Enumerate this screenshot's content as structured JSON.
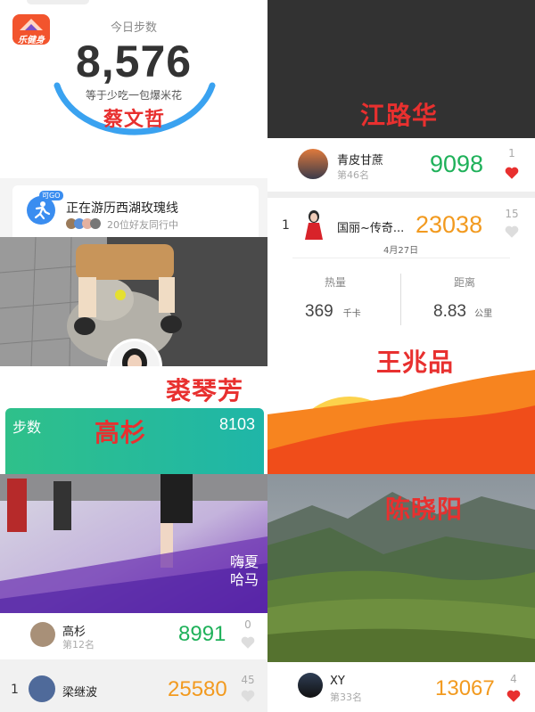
{
  "app": {
    "logo_text": "乐健身"
  },
  "steps_panel": {
    "label": "今日步数",
    "count": "8,576",
    "compare": "等于少吃一包爆米花",
    "person_name": "蔡文哲"
  },
  "challenge": {
    "badge": "可GO",
    "title": "正在游历西湖玫瑰线",
    "friends": "20位好友同行中"
  },
  "photo_left": {
    "person_name": "裘琴芳"
  },
  "green_card": {
    "label": "步数",
    "person_name": "高杉",
    "value": "8103"
  },
  "rank_gaoshan": {
    "name": "高杉",
    "rank": "第12名",
    "steps": "8991",
    "likes": "0"
  },
  "rank_liang": {
    "position": "1",
    "name": "梁继波",
    "steps": "25580",
    "likes": "45"
  },
  "dark_panel": {
    "person_name": "江路华"
  },
  "rank_qing": {
    "name": "青皮甘蔗",
    "rank": "第46名",
    "steps": "9098",
    "likes": "1"
  },
  "rank_guoli": {
    "position": "1",
    "name": "国丽~传奇...",
    "steps": "23038",
    "likes": "15",
    "date": "4月27日",
    "calorie_label": "热量",
    "calorie_value": "369",
    "calorie_unit": "千卡",
    "distance_label": "距离",
    "distance_value": "8.83",
    "distance_unit": "公里",
    "person_name": "王兆品"
  },
  "mountain": {
    "person_name": "陈晓阳"
  },
  "rank_xy": {
    "name": "XY",
    "rank": "第33名",
    "steps": "13067",
    "likes": "4"
  },
  "colors": {
    "accent_green": "#1fb15a",
    "accent_orange": "#f29a1f",
    "heart_red": "#e8302f",
    "overlay_red": "#e8302f"
  }
}
